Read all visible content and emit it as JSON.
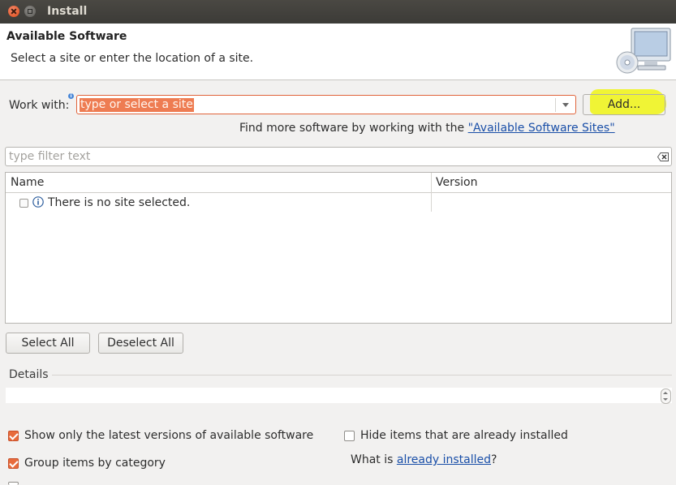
{
  "window": {
    "title": "Install"
  },
  "header": {
    "title": "Available Software",
    "description": "Select a site or enter the location of a site."
  },
  "work_with": {
    "label": "Work with:",
    "value": "type or select a site",
    "add_label": "Add..."
  },
  "find_more": {
    "prefix": "Find more software by working with the ",
    "link": "\"Available Software Sites\"",
    "suffix": " "
  },
  "filter": {
    "placeholder": "type filter text"
  },
  "table": {
    "columns": [
      "Name",
      "Version"
    ],
    "message": "There is no site selected."
  },
  "buttons": {
    "select_all": "Select All",
    "deselect_all": "Deselect All"
  },
  "details": {
    "label": "Details"
  },
  "options": {
    "latest_versions": {
      "label": "Show only the latest versions of available software",
      "checked": true
    },
    "group_by_category": {
      "label": "Group items by category",
      "checked": true
    },
    "hide_installed": {
      "label": "Hide items that are already installed",
      "checked": false
    },
    "what_is": {
      "prefix": "What is ",
      "link": "already installed",
      "suffix": "?"
    }
  },
  "colors": {
    "accent_orange": "#e86b3c",
    "highlight_yellow": "#f0f420",
    "link_blue": "#1a4fa8"
  }
}
